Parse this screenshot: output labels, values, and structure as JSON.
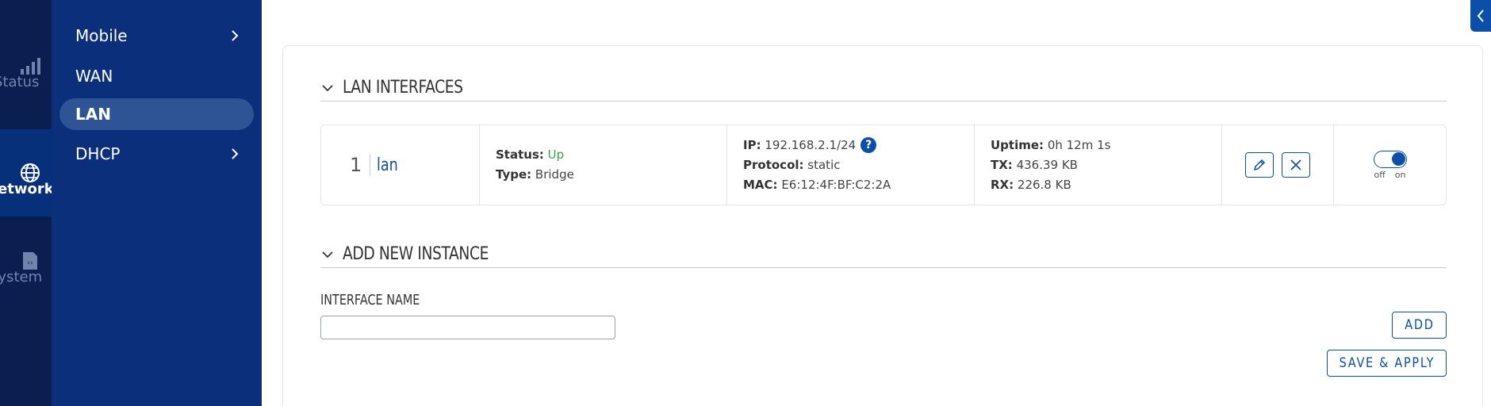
{
  "rail": {
    "items": [
      {
        "label": "Status",
        "icon": "signal-bars-icon"
      },
      {
        "label": "Network",
        "icon": "globe-icon"
      },
      {
        "label": "System",
        "icon": "sd-card-icon"
      }
    ]
  },
  "subnav": {
    "items": [
      {
        "label": "Mobile",
        "has_children": true
      },
      {
        "label": "WAN",
        "has_children": false
      },
      {
        "label": "LAN",
        "has_children": false,
        "active": true
      },
      {
        "label": "DHCP",
        "has_children": true
      }
    ]
  },
  "lan_interfaces": {
    "title": "LAN INTERFACES",
    "rows": [
      {
        "index": "1",
        "name": "lan",
        "status_label": "Status:",
        "status_value": "Up",
        "type_label": "Type:",
        "type_value": "Bridge",
        "ip_label": "IP:",
        "ip_value": "192.168.2.1/24",
        "protocol_label": "Protocol:",
        "protocol_value": "static",
        "mac_label": "MAC:",
        "mac_value": "E6:12:4F:BF:C2:2A",
        "uptime_label": "Uptime:",
        "uptime_value": "0h 12m 1s",
        "tx_label": "TX:",
        "tx_value": "436.39 KB",
        "rx_label": "RX:",
        "rx_value": "226.8 KB",
        "toggle_off": "off",
        "toggle_on": "on",
        "enabled": true
      }
    ]
  },
  "add_instance": {
    "title": "ADD NEW INSTANCE",
    "field_label": "INTERFACE NAME",
    "field_value": "",
    "add_label": "ADD"
  },
  "footer": {
    "save_apply_label": "SAVE & APPLY"
  },
  "colors": {
    "rail_bg": "#0a1f4f",
    "subnav_bg": "#0b2f7a",
    "accent": "#0b4fa8",
    "status_up": "#3aa54a"
  }
}
